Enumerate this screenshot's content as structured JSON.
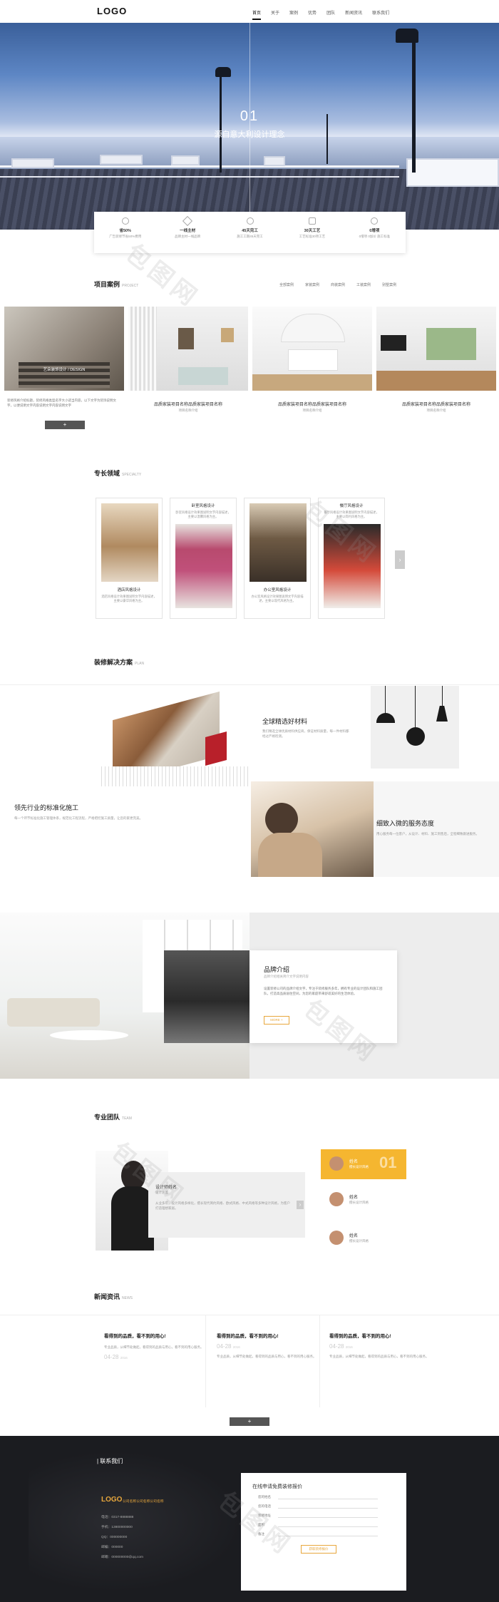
{
  "header": {
    "logo": "LOGO",
    "nav": [
      "首页",
      "关于",
      "案例",
      "优势",
      "团队",
      "新闻资讯",
      "联系我们"
    ]
  },
  "hero": {
    "num": "01",
    "subtitle": "源自意大利设计理念"
  },
  "features": [
    {
      "title": "省50%",
      "sub": "广告装修节省50%费用"
    },
    {
      "title": "一线主材",
      "sub": "品牌主材一线品牌"
    },
    {
      "title": "45天完工",
      "sub": "施工工期45天完工"
    },
    {
      "title": "30天工艺",
      "sub": "工艺标准30项工艺"
    },
    {
      "title": "0增项",
      "sub": "0增项 0加价 施工标准"
    }
  ],
  "projects": {
    "title": "项目案例",
    "title_en": "PROJECT",
    "tabs": [
      "全部案例",
      "家装案例",
      "商装案例",
      "工装案例",
      "别墅案例"
    ],
    "first_caption": "艺朵装饰设计 / DESIGN",
    "first_desc": "装修风格介绍标题，装修风格类型名字大小适当内容，以下文字为装饰说明文字，以便说明文字内容说明文字内容说明文字",
    "items": [
      {
        "title": "品质家装项目名称品质家装项目名称",
        "sub": "项目名称介绍"
      },
      {
        "title": "品质家装项目名称品质家装项目名称",
        "sub": "项目名称介绍"
      },
      {
        "title": "品质家装项目名称品质家装项目名称",
        "sub": "项目名称介绍"
      }
    ],
    "btn": "+"
  },
  "specialty": {
    "title": "专长领域",
    "title_en": "SPECIALTY",
    "cards": [
      {
        "name": "酒店风格设计",
        "desc": "酒店风格设计效果图说明文字内容描述，主要以豪华风格为主。"
      },
      {
        "name": "卧室风格设计",
        "desc": "卧室风格设计效果图说明文字内容描述，主要以温馨风格为主。"
      },
      {
        "name": "办公室风格设计",
        "desc": "办公室风格设计效果图说明文字内容描述，主要以现代风格为主。"
      },
      {
        "name": "餐厅风格设计",
        "desc": "餐厅风格设计效果图说明文字内容描述，主要以简约风格为主。"
      }
    ]
  },
  "solutions": {
    "title": "装修解决方案",
    "title_en": "PLAN",
    "left_title": "领先行业的标准化施工",
    "left_desc": "每一个环节标准化施工管理体系，规范化工程流程，严格把控施工质量，让您的家更完美。",
    "mat_title": "全球精选好材料",
    "mat_desc": "我们精选全球优质材料供应商，保证材料质量，每一件材料都经过严格检测。",
    "svc_title": "细致入微的服务态度",
    "svc_desc": "用心服务每一位客户，从设计、材料、施工到售后，全程细致跟进服务。"
  },
  "brand": {
    "title": "品牌介绍",
    "sub": "品牌介绍相关简介文字说明内容",
    "desc": "设置装修公司的品牌介绍文字，专注于装修服务多年，拥有专业的设计团队和施工团队，打造高品质居住空间，为您的家庭带来舒适美好的生活体验。",
    "btn": "MORE +"
  },
  "team": {
    "title": "专业团队",
    "title_en": "TEAM",
    "feature_name": "设计师姓名",
    "feature_role": "设计总监",
    "feature_desc": "从业多年，设计风格多样化，擅长现代简约风格、欧式风格、中式风格等多种设计风格，为客户打造理想家居。",
    "list": [
      {
        "name": "姓名",
        "role": "擅长设计风格",
        "num": "01"
      },
      {
        "name": "姓名",
        "role": "擅长设计风格"
      },
      {
        "name": "姓名",
        "role": "擅长设计风格"
      }
    ]
  },
  "news": {
    "title": "新闻资讯",
    "title_en": "NEWS",
    "items": [
      {
        "title": "看得到的品质，看不到的用心!",
        "date": "04-28",
        "year": "2016",
        "desc": "专业品质，从细节处做起，看得到的品质与用心，看不到的用心服务。"
      },
      {
        "title": "看得到的品质，看不到的用心!",
        "date": "04-28",
        "year": "2016",
        "desc": "专业品质，从细节处做起，看得到的品质与用心，看不到的用心服务。"
      },
      {
        "title": "看得到的品质，看不到的用心!",
        "date": "04-28",
        "year": "2016",
        "desc": "专业品质，从细节处做起，看得到的品质与用心，看不到的用心服务。"
      }
    ],
    "btn": "+"
  },
  "footer": {
    "title": "| 联系我们",
    "logo": "LOGO",
    "slogan": "公司名称公司名称公司名称",
    "lines": [
      "电话：0317-8888888",
      "手机：13800000000",
      "QQ：000000000",
      "邮编：000000",
      "邮箱：000000000@qq.com"
    ],
    "form_title": "在线申请免费装修报价",
    "fields": [
      "您的姓名",
      "您的电话",
      "装修地址",
      "面积",
      "备注"
    ],
    "submit": "获取装修报价"
  },
  "watermark": "包图网"
}
